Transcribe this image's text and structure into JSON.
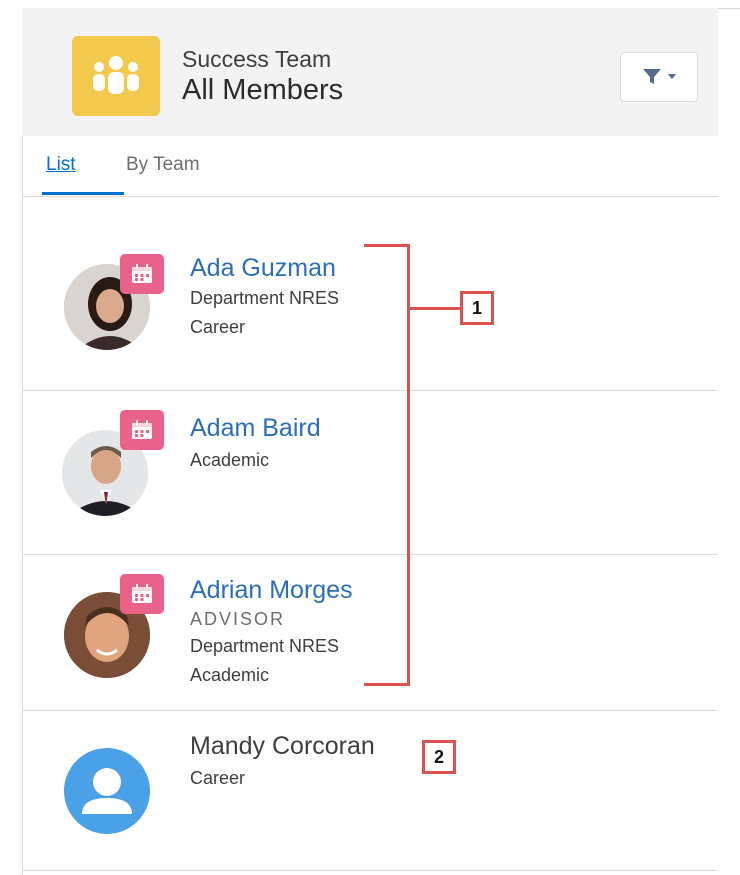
{
  "header": {
    "title_top": "Success Team",
    "title_main": "All Members"
  },
  "tabs": [
    {
      "label": "List",
      "active": true
    },
    {
      "label": "By Team",
      "active": false
    }
  ],
  "members": [
    {
      "name": "Ada Guzman",
      "lines": [
        "Department NRES",
        "Career"
      ],
      "has_calendar": true,
      "avatar": "photo"
    },
    {
      "name": "Adam Baird",
      "lines": [
        "Academic"
      ],
      "has_calendar": true,
      "avatar": "photo"
    },
    {
      "name": "Adrian Morges",
      "role": "ADVISOR",
      "lines": [
        "Department NRES",
        "Academic"
      ],
      "has_calendar": true,
      "avatar": "photo"
    },
    {
      "name": "Mandy Corcoran",
      "lines": [
        "Career"
      ],
      "has_calendar": false,
      "avatar": "default-user"
    }
  ],
  "callouts": [
    "1",
    "2"
  ],
  "icons": {
    "app": "team-icon",
    "filter": "filter-icon",
    "calendar": "calendar-icon",
    "default_avatar": "user-icon"
  },
  "colors": {
    "link": "#2a6ebb",
    "app_icon": "#f2c94c",
    "calendar_badge": "#e8628a",
    "default_avatar": "#4ba1e8",
    "annotation": "#d9534f"
  }
}
